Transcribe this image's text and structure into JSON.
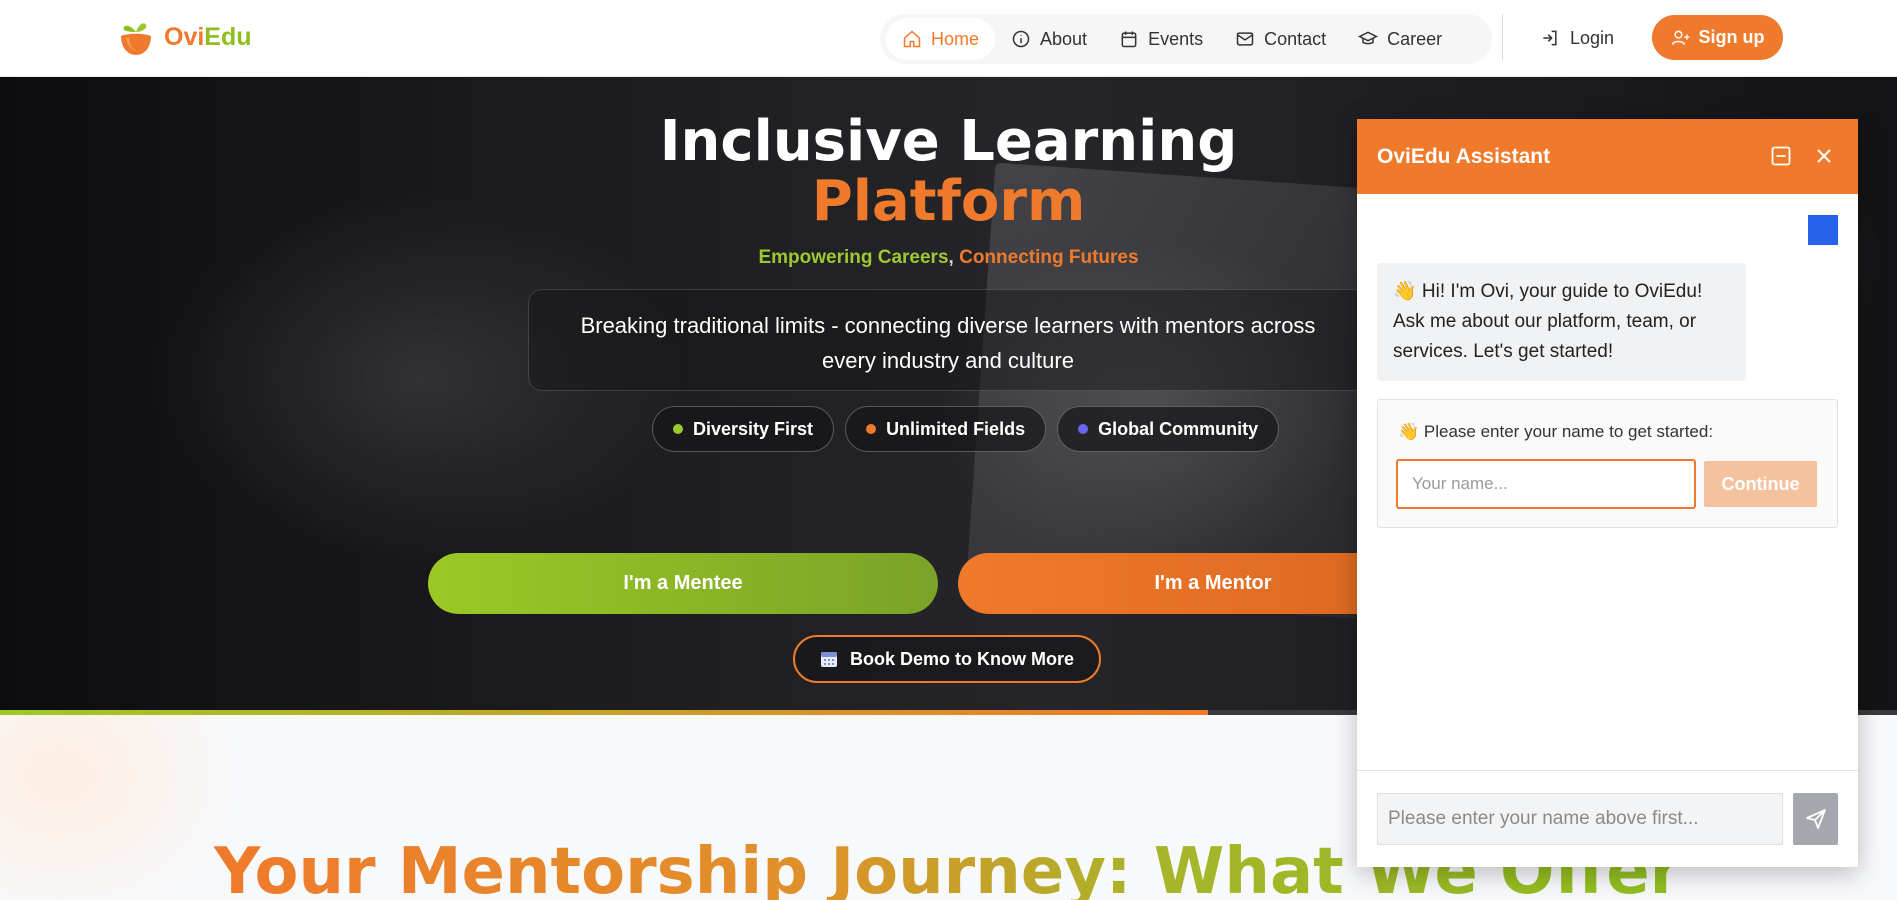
{
  "brand": {
    "name_part1": "Ovi",
    "name_part2": "Edu",
    "orange": "#f07a2b",
    "green": "#8fbf1f"
  },
  "nav": {
    "items": [
      {
        "label": "Home",
        "icon": "home-icon",
        "active": true
      },
      {
        "label": "About",
        "icon": "info-icon"
      },
      {
        "label": "Events",
        "icon": "calendar-icon"
      },
      {
        "label": "Contact",
        "icon": "mail-icon"
      },
      {
        "label": "Career",
        "icon": "graduation-cap-icon"
      }
    ],
    "login_label": "Login",
    "signup_label": "Sign up"
  },
  "hero": {
    "title_line1": "Inclusive Learning",
    "title_line2": "Platform",
    "tagline_part1": "Empowering Careers",
    "tagline_sep": ",",
    "tagline_part2": "Connecting Futures",
    "description": "Breaking traditional limits - connecting diverse learners with mentors across every industry and culture",
    "badges": [
      {
        "label": "Diversity First",
        "color": "#9cc931"
      },
      {
        "label": "Unlimited Fields",
        "color": "#f07a2b"
      },
      {
        "label": "Global Community",
        "color": "#6366f1"
      }
    ],
    "mentee_button": "I'm a Mentee",
    "mentor_button": "I'm a Mentor",
    "demo_button": "Book Demo to Know More",
    "progress": 0.637
  },
  "section": {
    "title": "Your Mentorship Journey: What We Offer"
  },
  "chat": {
    "title": "OviEdu Assistant",
    "greeting": "👋 Hi! I'm Ovi, your guide to OviEdu! Ask me about our platform, team, or services. Let's get started!",
    "name_prompt": "👋 Please enter your name to get started:",
    "name_placeholder": "Your name...",
    "continue_label": "Continue",
    "message_placeholder": "Please enter your name above first..."
  }
}
